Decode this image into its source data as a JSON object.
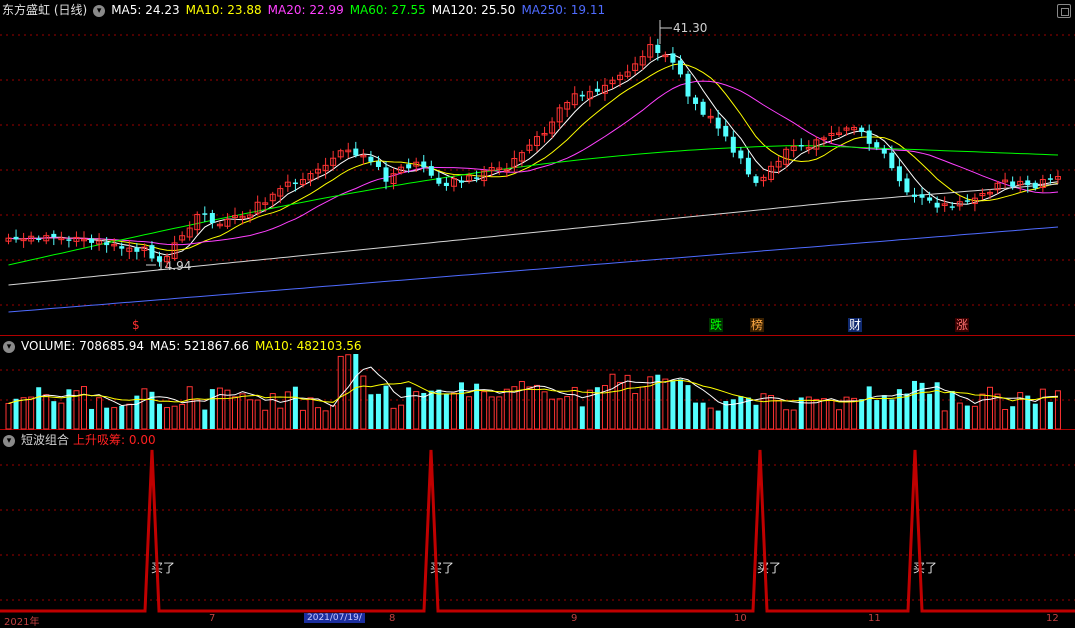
{
  "price_panel": {
    "title": "东方盛虹 (日线)",
    "indicators": [
      {
        "text": "MA5: 24.23",
        "color": "#ffffff"
      },
      {
        "text": "MA10: 23.88",
        "color": "#ffff00"
      },
      {
        "text": "MA20: 22.99",
        "color": "#ff40ff"
      },
      {
        "text": "MA60: 27.55",
        "color": "#00ff00"
      },
      {
        "text": "MA120: 25.50",
        "color": "#ffffff"
      },
      {
        "text": "MA250: 19.11",
        "color": "#4f6bff"
      }
    ],
    "high_label": "41.30",
    "low_label": "14.94"
  },
  "events": [
    {
      "text": "$",
      "color": "#ff3030"
    },
    {
      "text": "跌",
      "color": "#00ff00",
      "bg": "#003000"
    },
    {
      "text": "榜",
      "color": "#ffaa44",
      "bg": "#3a2000"
    },
    {
      "text": "财",
      "color": "#ffffff",
      "bg": "#102a70"
    },
    {
      "text": "涨",
      "color": "#ff7070",
      "bg": "#3a0000"
    }
  ],
  "volume_panel": {
    "indicators": [
      {
        "text": "VOLUME: 708685.94",
        "color": "#ffffff"
      },
      {
        "text": "MA5: 521867.66",
        "color": "#ffffff"
      },
      {
        "text": "MA10: 482103.56",
        "color": "#ffff00"
      }
    ]
  },
  "signal_panel": {
    "title": "短波组合",
    "indicator": {
      "text": "上升吸筹: 0.00",
      "color": "#ff2020"
    },
    "buy_label": "买了"
  },
  "x_axis": {
    "labels": [
      "2021年",
      "7",
      "8",
      "9",
      "10",
      "11",
      "12"
    ],
    "date_box": "2021/07/19/"
  },
  "colors": {
    "up": "#ff3333",
    "down": "#54ffff",
    "signal": "#c00000",
    "grid": "#9b0000"
  }
}
